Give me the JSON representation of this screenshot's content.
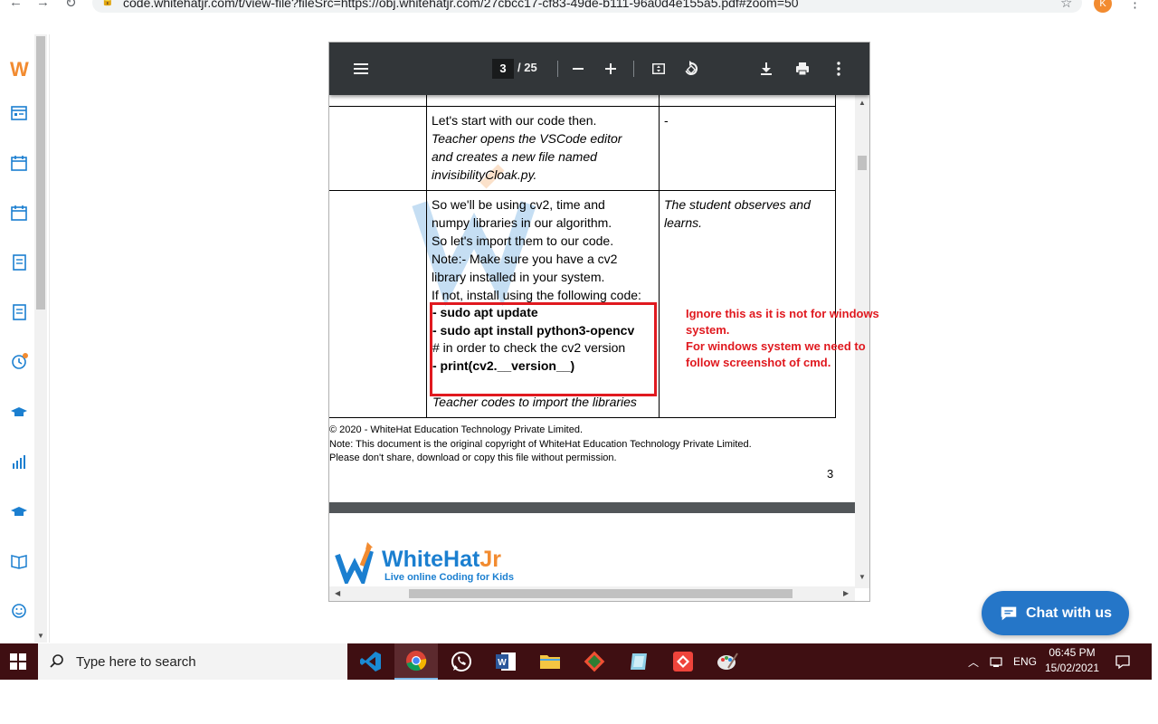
{
  "browser": {
    "url": "code.whitehatjr.com/t/view-file?fileSrc=https://obj.whitehatjr.com/27cbcc17-cf83-49de-b111-96a0d4e155a5.pdf#zoom=50",
    "profile_initial": "K"
  },
  "sidebar": {
    "logo": "W",
    "items": [
      "dashboard-icon",
      "calendar-icon",
      "calendar-icon",
      "report-icon",
      "report-icon",
      "history-icon",
      "graduation-cap-icon",
      "stats-icon",
      "graduation-cap-icon",
      "book-icon",
      "smiley-icon"
    ]
  },
  "pdf_toolbar": {
    "current_page": "3",
    "total_pages": "/ 25"
  },
  "pdf_page": {
    "row1_teacher": [
      "Let's start with our code then.",
      "Teacher opens the VSCode editor",
      "and creates a new file named",
      "invisibilityCloak.py."
    ],
    "row1_student": "-",
    "row2_teacher": [
      "So we'll be using cv2, time and",
      "numpy libraries in our algorithm.",
      "So let's import them to our code.",
      "Note:- Make sure you have a cv2",
      "library installed in your system.",
      "If not, install using the following code:"
    ],
    "row2_code": [
      "- sudo apt update",
      "- sudo apt install python3-opencv",
      "# in order to check the cv2 version",
      "- print(cv2.__version__)"
    ],
    "row2_footer": "Teacher codes to import the libraries",
    "row2_student": [
      "The student observes and",
      "learns."
    ],
    "footer_lines": [
      "© 2020 - WhiteHat Education Technology Private Limited.",
      "Note: This document is the original copyright of WhiteHat Education Technology Private Limited.",
      "Please don't share, download or copy this file without permission."
    ],
    "page_number": "3",
    "brand": "WhiteHat",
    "brand_accent": "Jr",
    "brand_tagline": "Live online Coding for Kids"
  },
  "annotation": {
    "lines": [
      "Ignore this as it is not for windows",
      "system.",
      "For windows system we need to",
      "follow screenshot of cmd."
    ],
    "color": "#e0191f"
  },
  "chat": {
    "label": "Chat with us"
  },
  "taskbar": {
    "search_placeholder": "Type here to search",
    "language": "ENG",
    "time": "06:45 PM",
    "date": "15/02/2021"
  }
}
